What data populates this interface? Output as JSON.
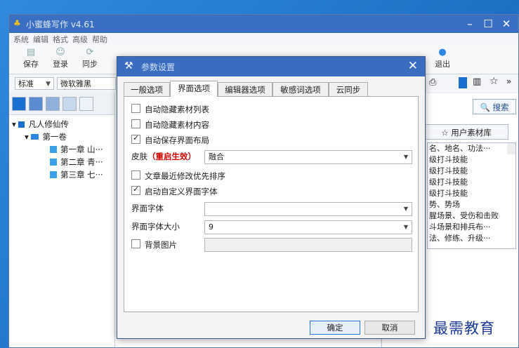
{
  "app": {
    "title": "小蜜蜂写作 v4.61",
    "menu": [
      "系统",
      "编辑",
      "格式",
      "高级",
      "帮助"
    ],
    "toolbar": {
      "save": "保存",
      "login": "登录",
      "sync": "同步",
      "exit": "退出"
    },
    "style_select": "标准",
    "font_select": "微软雅黑",
    "search_button": "搜索",
    "user_library_tab": "用户素材库",
    "tree": {
      "book": "凡人修仙传",
      "volume": "第一卷",
      "chapters": [
        "第一章 山···",
        "第二章 青···",
        "第三章 七···"
      ]
    },
    "library_items": [
      "名、地名、功法···",
      "级打斗技能",
      "级打斗技能",
      "级打斗技能",
      "级打斗技能",
      "势、势场",
      "腥场景、受伤和击败",
      "斗场景和排兵布···",
      "法、修练、升级···"
    ]
  },
  "dialog": {
    "title": "参数设置",
    "tabs": [
      "一般选项",
      "界面选项",
      "编辑器选项",
      "敏感词选项",
      "云同步"
    ],
    "active_tab": "界面选项",
    "options": {
      "auto_hide_list": {
        "label": "自动隐藏素材列表",
        "checked": false
      },
      "auto_hide_content": {
        "label": "自动隐藏素材内容",
        "checked": false
      },
      "auto_save_layout": {
        "label": "自动保存界面布局",
        "checked": true
      },
      "skin_label": "皮肤",
      "skin_note": "（重启生效）",
      "skin_value": "融合",
      "recent_sort": {
        "label": "文章最近修改优先排序",
        "checked": false
      },
      "custom_font": {
        "label": "启动自定义界面字体",
        "checked": true
      },
      "font_label": "界面字体",
      "font_value": "",
      "font_size_label": "界面字体大小",
      "font_size_value": "9",
      "bg_image": {
        "label": "背景图片",
        "checked": false
      },
      "bg_image_value": ""
    },
    "ok_button": "确定",
    "cancel_button": "取消"
  },
  "watermark": "最需教育"
}
